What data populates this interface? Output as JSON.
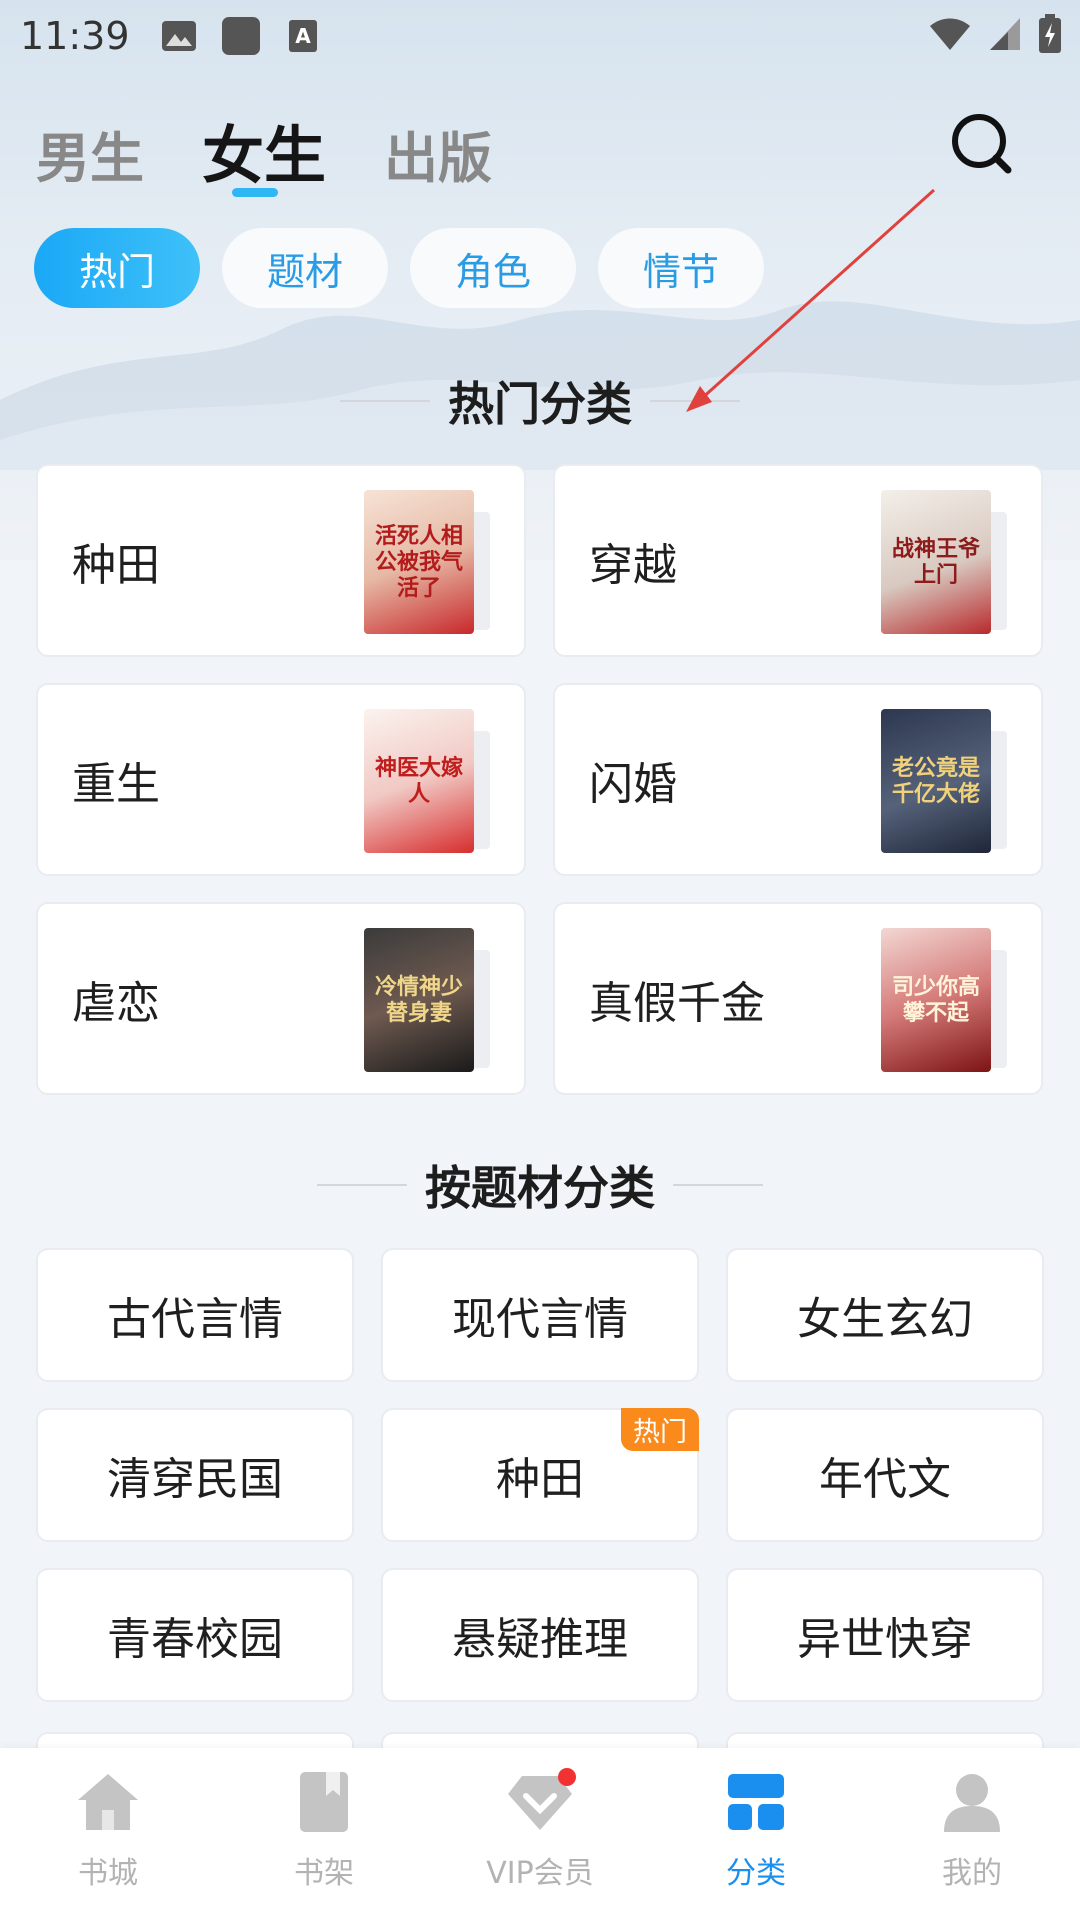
{
  "status_bar": {
    "time": "11:39"
  },
  "top_tabs": [
    {
      "label": "男生"
    },
    {
      "label": "女生"
    },
    {
      "label": "出版"
    }
  ],
  "filter_pills": [
    {
      "label": "热门"
    },
    {
      "label": "题材"
    },
    {
      "label": "角色"
    },
    {
      "label": "情节"
    }
  ],
  "hot_section": {
    "title": "热门分类",
    "items": [
      {
        "label": "种田",
        "cover_text": "活死人相公被我气活了"
      },
      {
        "label": "穿越",
        "cover_text": "战神王爷上门"
      },
      {
        "label": "重生",
        "cover_text": "神医大嫁人"
      },
      {
        "label": "闪婚",
        "cover_text": "老公竟是千亿大佬"
      },
      {
        "label": "虐恋",
        "cover_text": "冷情神少替身妻"
      },
      {
        "label": "真假千金",
        "cover_text": "司少你高攀不起"
      }
    ]
  },
  "theme_section": {
    "title": "按题材分类",
    "items": [
      {
        "label": "古代言情"
      },
      {
        "label": "现代言情"
      },
      {
        "label": "女生玄幻"
      },
      {
        "label": "清穿民国"
      },
      {
        "label": "种田",
        "tag": "热门"
      },
      {
        "label": "年代文"
      },
      {
        "label": "青春校园"
      },
      {
        "label": "悬疑推理"
      },
      {
        "label": "异世快穿"
      }
    ]
  },
  "bottom_nav": [
    {
      "label": "书城",
      "icon": "home-icon"
    },
    {
      "label": "书架",
      "icon": "bookshelf-icon"
    },
    {
      "label": "VIP会员",
      "icon": "vip-diamond-icon"
    },
    {
      "label": "分类",
      "icon": "category-grid-icon"
    },
    {
      "label": "我的",
      "icon": "profile-icon"
    }
  ],
  "colors": {
    "accent": "#1a8ff0",
    "pill_active": "#1aa8f6",
    "pill_text": "#2a9ce6",
    "hot_tag": "#fb8a1c",
    "annotation_arrow": "#e0413d"
  }
}
